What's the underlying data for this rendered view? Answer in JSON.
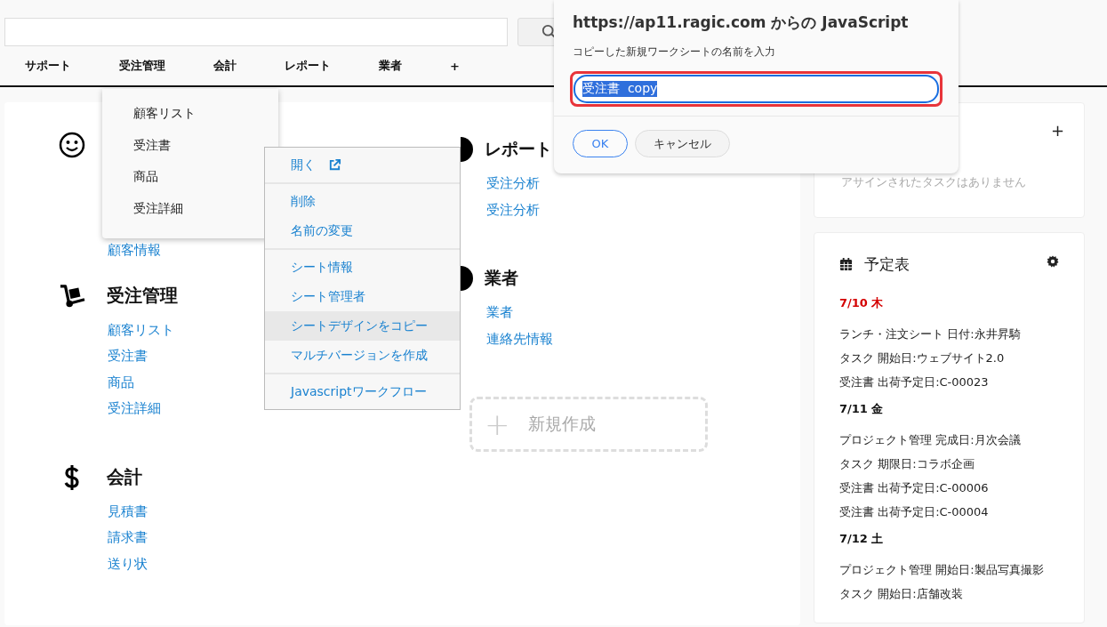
{
  "tabs": [
    {
      "label": "サポート"
    },
    {
      "label": "受注管理"
    },
    {
      "label": "会計"
    },
    {
      "label": "レポート"
    },
    {
      "label": "業者"
    },
    {
      "label": "+"
    }
  ],
  "tab_dropdown": {
    "items": [
      "顧客リスト",
      "受注書",
      "商品",
      "受注詳細"
    ]
  },
  "columns": [
    [
      {
        "kind": "smiley",
        "links": [
          "顧客情報"
        ]
      },
      {
        "kind": "cart",
        "title": "受注管理",
        "links": [
          "顧客リスト",
          "受注書",
          "商品",
          "受注詳細"
        ]
      },
      {
        "kind": "dollar",
        "title": "会計",
        "links": [
          "見積書",
          "請求書",
          "送り状"
        ]
      }
    ],
    [
      {
        "kind": "dot",
        "title": "レポート",
        "links": [
          "受注分析",
          "受注分析"
        ]
      },
      {
        "kind": "dot",
        "title": "業者",
        "links": [
          "業者",
          "連絡先情報"
        ]
      }
    ]
  ],
  "new_sheet": {
    "icon": "+",
    "label": "新規作成"
  },
  "context_menu": {
    "groups": [
      [
        {
          "label": "開く",
          "kind": "external",
          "selected": false
        }
      ],
      [
        {
          "label": "削除",
          "kind": "plain",
          "selected": false
        },
        {
          "label": "名前の変更",
          "kind": "plain",
          "selected": false
        }
      ],
      [
        {
          "label": "シート情報",
          "kind": "plain",
          "selected": false
        },
        {
          "label": "シート管理者",
          "kind": "plain",
          "selected": false
        },
        {
          "label": "シートデザインをコピー",
          "kind": "plain",
          "selected": true
        },
        {
          "label": "マルチバージョンを作成",
          "kind": "plain",
          "selected": false
        }
      ],
      [
        {
          "label": "Javascriptワークフロー",
          "kind": "plain",
          "selected": false
        }
      ]
    ]
  },
  "tasks_card": {
    "add": "+",
    "empty_message": "アサインされたタスクはありません"
  },
  "schedule": {
    "title": "予定表",
    "days": [
      {
        "date": "7/10 木",
        "today": true,
        "events": [
          "ランチ・注文シート 日付:永井昇騎",
          "タスク 開始日:ウェブサイト2.0",
          "受注書 出荷予定日:C-00023"
        ]
      },
      {
        "date": "7/11 金",
        "today": false,
        "events": [
          "プロジェクト管理 完成日:月次会議",
          "タスク 期限日:コラボ企画",
          "受注書 出荷予定日:C-00006",
          "受注書 出荷予定日:C-00004"
        ]
      },
      {
        "date": "7/12 土",
        "today": false,
        "events": [
          "プロジェクト管理 開始日:製品写真撮影",
          "タスク 開始日:店舗改装"
        ]
      }
    ]
  },
  "dialog": {
    "title": "https://ap11.ragic.com からの JavaScript",
    "message": "コピーした新規ワークシートの名前を入力",
    "value": "受注書  copy",
    "value_selected": true,
    "buttons": [
      {
        "label": "OK",
        "primary": true
      },
      {
        "label": "キャンセル",
        "primary": false
      }
    ]
  }
}
